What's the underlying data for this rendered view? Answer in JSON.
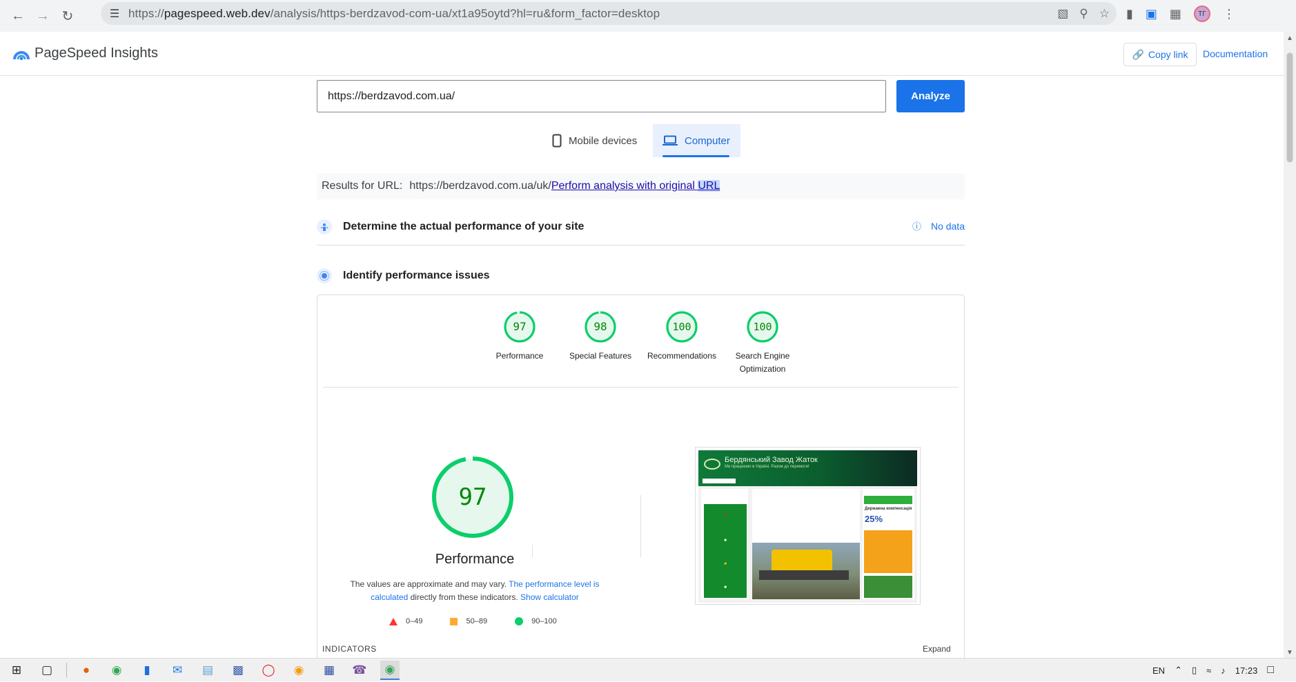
{
  "browser": {
    "url_prefix": "https://",
    "url_host": "pagespeed.web.dev",
    "url_path": "/analysis/https-berdzavod-com-ua/xt1a95oytd?hl=ru&form_factor=desktop",
    "nav_icons": [
      "back-arrow-icon",
      "forward-arrow-icon",
      "reload-icon"
    ],
    "omnibox_icons": [
      "translate-icon",
      "zoom-icon",
      "bookmark-star-icon"
    ],
    "extension_icons": [
      "extension-a-icon",
      "google-translate-icon",
      "puzzle-icon"
    ],
    "avatar_text": "ТГ"
  },
  "header": {
    "title": "PageSpeed Insights",
    "copy_link": "Copy link",
    "documentation": "Documentation"
  },
  "form": {
    "url_value": "https://berdzavod.com.ua/",
    "analyze_label": "Analyze"
  },
  "tabs": {
    "mobile": "Mobile devices",
    "desktop": "Computer",
    "active": "desktop"
  },
  "results": {
    "label": "Results for URL:",
    "url": "https://berdzavod.com.ua/uk/",
    "original_link_prefix": " Perform analysis with original ",
    "original_link_highlight": "URL"
  },
  "sections": {
    "field_title": "Determine the actual performance of your site",
    "field_status": "No data",
    "lab_title": "Identify performance issues"
  },
  "scores": [
    {
      "value": "97",
      "label": "Performance",
      "fraction": 0.97
    },
    {
      "value": "98",
      "label": "Special Features",
      "fraction": 0.98
    },
    {
      "value": "100",
      "label": "Recommendations",
      "fraction": 1.0
    },
    {
      "value": "100",
      "label": "Search Engine Optimization",
      "fraction": 1.0
    }
  ],
  "performance": {
    "score": "97",
    "fraction": 0.97,
    "title": "Performance",
    "desc_plain_1": "The values are approximate and may vary. ",
    "desc_link_1": "The performance level is calculated",
    "desc_plain_2": " directly from these indicators. ",
    "desc_link_2": "Show calculator",
    "legend": [
      "0–49",
      "50–89",
      "90–100"
    ]
  },
  "thumbnail": {
    "site_title": "Бердянський Завод Жаток",
    "site_subtitle": "Ми працюємо в Україні. Разом до перемоги!",
    "discount": "25%",
    "compensation": "Державна компенсація"
  },
  "indicators": {
    "label": "INDICATORS",
    "expand": "Expand"
  },
  "colors": {
    "good": "#0cce6b",
    "good_text": "#008800",
    "good_bg": "#e6f8ee",
    "accent": "#1a73e8"
  },
  "taskbar": {
    "lang": "EN",
    "time": "17:23"
  }
}
